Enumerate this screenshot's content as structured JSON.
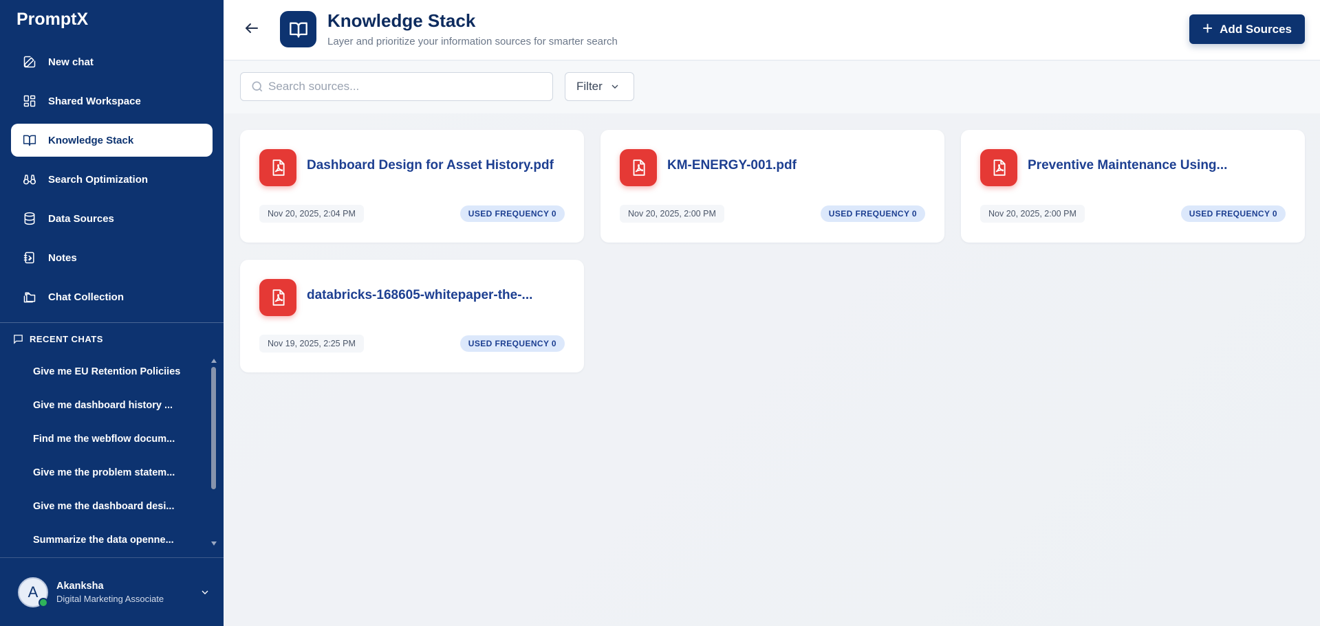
{
  "app": {
    "brand": "PromptX"
  },
  "sidebar": {
    "nav": [
      {
        "label": "New chat",
        "icon": "edit-icon",
        "active": false
      },
      {
        "label": "Shared Workspace",
        "icon": "grid-icon",
        "active": false
      },
      {
        "label": "Knowledge Stack",
        "icon": "book-icon",
        "active": true
      },
      {
        "label": "Search Optimization",
        "icon": "binoculars-icon",
        "active": false
      },
      {
        "label": "Data Sources",
        "icon": "database-icon",
        "active": false
      },
      {
        "label": "Notes",
        "icon": "notebook-icon",
        "active": false
      },
      {
        "label": "Chat Collection",
        "icon": "folders-icon",
        "active": false
      }
    ],
    "recent_heading": "RECENT CHATS",
    "recent": [
      "Give me EU Retention Policiies",
      "Give me dashboard history ...",
      "Find me the webflow docum...",
      "Give me the problem statem...",
      "Give me the dashboard desi...",
      "Summarize the data openne..."
    ],
    "user": {
      "initial": "A",
      "name": "Akanksha",
      "role": "Digital Marketing Associate",
      "status_color": "#2fb35a"
    }
  },
  "header": {
    "title": "Knowledge Stack",
    "subtitle": "Layer and prioritize your information sources for smarter search",
    "add_label": "Add Sources"
  },
  "toolbar": {
    "search_placeholder": "Search sources...",
    "filter_label": "Filter"
  },
  "sources": [
    {
      "title": "Dashboard Design for Asset History.pdf",
      "date": "Nov 20, 2025, 2:04 PM",
      "badge": "USED FREQUENCY 0"
    },
    {
      "title": "KM-ENERGY-001.pdf",
      "date": "Nov 20, 2025, 2:00 PM",
      "badge": "USED FREQUENCY 0"
    },
    {
      "title": "Preventive Maintenance Using...",
      "date": "Nov 20, 2025, 2:00 PM",
      "badge": "USED FREQUENCY 0"
    },
    {
      "title": "databricks-168605-whitepaper-the-...",
      "date": "Nov 19, 2025, 2:25 PM",
      "badge": "USED FREQUENCY 0"
    }
  ],
  "colors": {
    "brand": "#0d3370",
    "pdf": "#e53935",
    "badge_bg": "#dce8fb"
  }
}
